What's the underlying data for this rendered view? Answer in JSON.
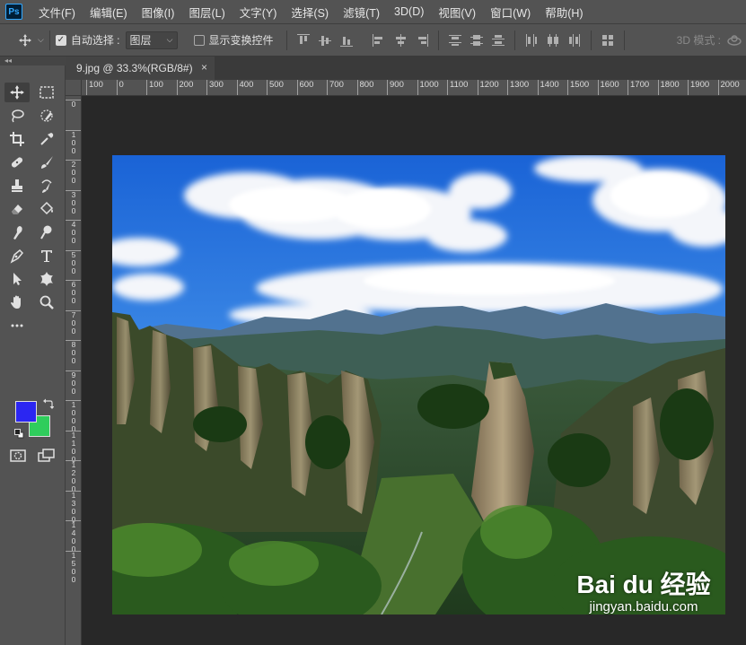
{
  "app": {
    "logo": "Ps"
  },
  "menu": [
    "文件(F)",
    "编辑(E)",
    "图像(I)",
    "图层(L)",
    "文字(Y)",
    "选择(S)",
    "滤镜(T)",
    "3D(D)",
    "视图(V)",
    "窗口(W)",
    "帮助(H)"
  ],
  "options": {
    "auto_select_label": "自动选择 :",
    "auto_select_checked": true,
    "auto_select_target": "图层",
    "show_transform_label": "显示变换控件",
    "show_transform_checked": false,
    "mode_3d_label": "3D 模式 :"
  },
  "panel_collapse": "◂◂",
  "tab": {
    "title": "9.jpg @ 33.3%(RGB/8#)",
    "close": "×"
  },
  "ruler": {
    "horizontal": [
      "100",
      "0",
      "100",
      "200",
      "300",
      "400",
      "500",
      "600",
      "700",
      "800",
      "900",
      "1000",
      "1100",
      "1200",
      "1300",
      "1400",
      "1500",
      "1600",
      "1700",
      "1800",
      "1900",
      "2000",
      "2"
    ],
    "vertical": [
      "0",
      "1\n0\n0",
      "2\n0\n0",
      "3\n0\n0",
      "4\n0\n0",
      "5\n0\n0",
      "6\n0\n0",
      "7\n0\n0",
      "8\n0\n0",
      "9\n0\n0",
      "1\n0\n0\n0",
      "1\n1\n0\n0",
      "1\n2\n0\n0",
      "1\n3\n0\n0",
      "1\n4\n0\n0",
      "1\n5\n0\n0"
    ]
  },
  "colors": {
    "foreground": "#2b26f2",
    "background": "#2fcd5c"
  },
  "tools": [
    "move-tool",
    "marquee-tool",
    "lasso-tool",
    "quick-selection-tool",
    "crop-tool",
    "eyedropper-tool",
    "healing-brush-tool",
    "brush-tool",
    "clone-stamp-tool",
    "history-brush-tool",
    "eraser-tool",
    "paint-bucket-tool",
    "smudge-tool",
    "dodge-tool",
    "pen-tool",
    "type-tool",
    "path-selection-tool",
    "custom-shape-tool",
    "hand-tool",
    "zoom-tool",
    "more-tools"
  ],
  "watermark": {
    "logo": "Bai du 经验",
    "url": "jingyan.baidu.com"
  }
}
